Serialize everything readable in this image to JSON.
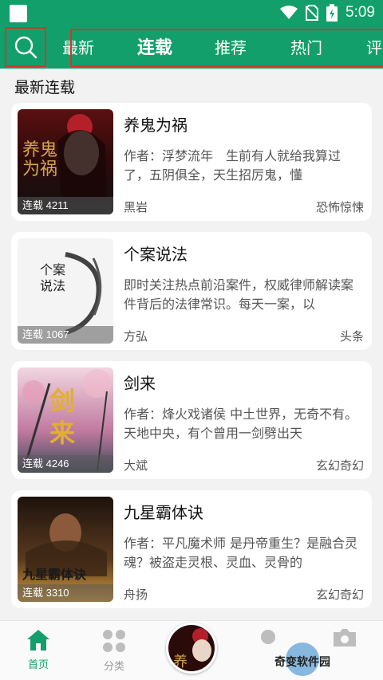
{
  "status_bar": {
    "time": "5:09"
  },
  "top_nav": {
    "tabs": [
      {
        "label": "最新"
      },
      {
        "label": "连载",
        "active": true
      },
      {
        "label": "推荐"
      },
      {
        "label": "热门"
      },
      {
        "label": "评"
      }
    ]
  },
  "section": {
    "title": "最新连载"
  },
  "books": [
    {
      "title": "养鬼为祸",
      "desc": "作者：浮梦流年　生前有人就给我算过了，五阴俱全，天生招厉鬼，懂",
      "author": "黑岩",
      "genre": "恐怖惊悚",
      "badge": "连载 4211",
      "cover_text": "养鬼为祸"
    },
    {
      "title": "个案说法",
      "desc": "即时关注热点前沿案件，权威律师解读案件背后的法律常识。每天一案，以",
      "author": "方弘",
      "genre": "头条",
      "badge": "连载 1067",
      "cover_text": "个案说法"
    },
    {
      "title": "剑来",
      "desc": "作者：烽火戏诸侯 中土世界，无奇不有。天地中央，有个曾用一剑劈出天",
      "author": "大斌",
      "genre": "玄幻奇幻",
      "badge": "连载 4246",
      "cover_text": "剑来"
    },
    {
      "title": "九星霸体诀",
      "desc": "作者：平凡魔术师 是丹帝重生？是融合灵魂？被盗走灵根、灵血、灵骨的",
      "author": "舟扬",
      "genre": "玄幻奇幻",
      "badge": "连载 3310",
      "cover_text": "九星霸体诀"
    }
  ],
  "bottom_nav": {
    "items": [
      {
        "label": "首页",
        "active": true
      },
      {
        "label": "分类"
      }
    ]
  },
  "watermark": "奇变软件园",
  "colors": {
    "primary": "#139f6b",
    "highlight_box": "#d3382a"
  }
}
